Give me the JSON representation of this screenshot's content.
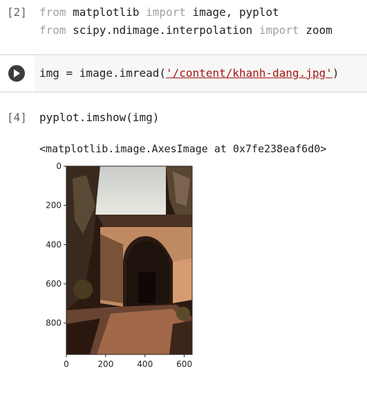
{
  "cells": [
    {
      "exec_count": "[2]",
      "lines": [
        {
          "parts": [
            {
              "t": "from",
              "c": "kw2"
            },
            {
              "t": " matplotlib ",
              "c": ""
            },
            {
              "t": "import",
              "c": "kw2"
            },
            {
              "t": " image, pyplot",
              "c": ""
            }
          ]
        },
        {
          "parts": [
            {
              "t": "from",
              "c": "kw2"
            },
            {
              "t": " scipy.ndimage.interpolation ",
              "c": ""
            },
            {
              "t": "import",
              "c": "kw2"
            },
            {
              "t": " zoom",
              "c": ""
            }
          ]
        }
      ]
    },
    {
      "exec_count": "",
      "lines": [
        {
          "parts": [
            {
              "t": "img = image.imread(",
              "c": ""
            },
            {
              "t": "'/content/khanh-dang.jpg'",
              "c": "str"
            },
            {
              "t": ")",
              "c": ""
            }
          ]
        }
      ]
    },
    {
      "exec_count": "[4]",
      "lines": [
        {
          "parts": [
            {
              "t": "pyplot.imshow(img)",
              "c": ""
            }
          ]
        }
      ]
    }
  ],
  "output": {
    "repr": "<matplotlib.image.AxesImage at 0x7fe238eaf6d0>"
  },
  "chart_data": {
    "type": "image",
    "y_ticks": [
      "0",
      "200",
      "400",
      "600",
      "800"
    ],
    "x_ticks": [
      "0",
      "200",
      "400",
      "600"
    ],
    "x_tick_values": [
      0,
      200,
      400,
      600
    ],
    "y_tick_values": [
      0,
      200,
      400,
      600,
      800
    ],
    "xlim": [
      0,
      640
    ],
    "ylim": [
      960,
      0
    ]
  },
  "colors": {
    "code_bg": "#f7f7f7",
    "run_button": "#3c3c3c"
  }
}
